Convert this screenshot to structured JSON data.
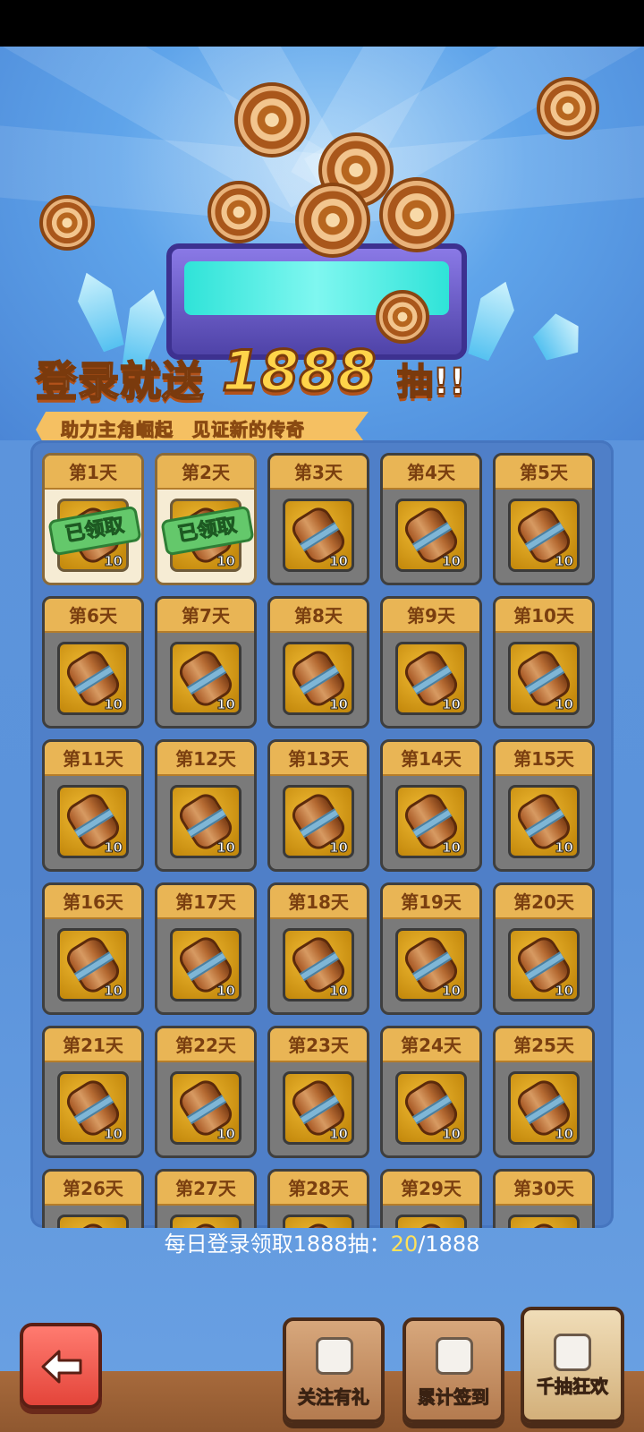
{
  "banner": {
    "title_prefix": "登录就送",
    "title_number": "1888",
    "title_suffix": "抽!!",
    "subtitle": "助力主角崛起　见证新的传奇"
  },
  "days": [
    {
      "label": "第1天",
      "qty": "10",
      "claimed": true,
      "stamp": "已领取"
    },
    {
      "label": "第2天",
      "qty": "10",
      "claimed": true,
      "stamp": "已领取"
    },
    {
      "label": "第3天",
      "qty": "10",
      "claimed": false
    },
    {
      "label": "第4天",
      "qty": "10",
      "claimed": false
    },
    {
      "label": "第5天",
      "qty": "10",
      "claimed": false
    },
    {
      "label": "第6天",
      "qty": "10",
      "claimed": false
    },
    {
      "label": "第7天",
      "qty": "10",
      "claimed": false
    },
    {
      "label": "第8天",
      "qty": "10",
      "claimed": false
    },
    {
      "label": "第9天",
      "qty": "10",
      "claimed": false
    },
    {
      "label": "第10天",
      "qty": "10",
      "claimed": false
    },
    {
      "label": "第11天",
      "qty": "10",
      "claimed": false
    },
    {
      "label": "第12天",
      "qty": "10",
      "claimed": false
    },
    {
      "label": "第13天",
      "qty": "10",
      "claimed": false
    },
    {
      "label": "第14天",
      "qty": "10",
      "claimed": false
    },
    {
      "label": "第15天",
      "qty": "10",
      "claimed": false
    },
    {
      "label": "第16天",
      "qty": "10",
      "claimed": false
    },
    {
      "label": "第17天",
      "qty": "10",
      "claimed": false
    },
    {
      "label": "第18天",
      "qty": "10",
      "claimed": false
    },
    {
      "label": "第19天",
      "qty": "10",
      "claimed": false
    },
    {
      "label": "第20天",
      "qty": "10",
      "claimed": false
    },
    {
      "label": "第21天",
      "qty": "10",
      "claimed": false
    },
    {
      "label": "第22天",
      "qty": "10",
      "claimed": false
    },
    {
      "label": "第23天",
      "qty": "10",
      "claimed": false
    },
    {
      "label": "第24天",
      "qty": "10",
      "claimed": false
    },
    {
      "label": "第25天",
      "qty": "10",
      "claimed": false
    },
    {
      "label": "第26天",
      "qty": "",
      "claimed": false
    },
    {
      "label": "第27天",
      "qty": "",
      "claimed": false
    },
    {
      "label": "第28天",
      "qty": "",
      "claimed": false
    },
    {
      "label": "第29天",
      "qty": "",
      "claimed": false
    },
    {
      "label": "第30天",
      "qty": "",
      "claimed": false
    }
  ],
  "progress": {
    "label": "每日登录领取1888抽：",
    "current": "20",
    "total": "/1888"
  },
  "actions": {
    "follow": "关注有礼",
    "cumulative": "累计签到",
    "draw_carnival": "千抽狂欢"
  },
  "icons": {
    "back": "left-arrow-icon",
    "follow": "gift-box-icon",
    "cumulative": "calendar-icon",
    "draw_carnival": "star-gift-icon"
  }
}
